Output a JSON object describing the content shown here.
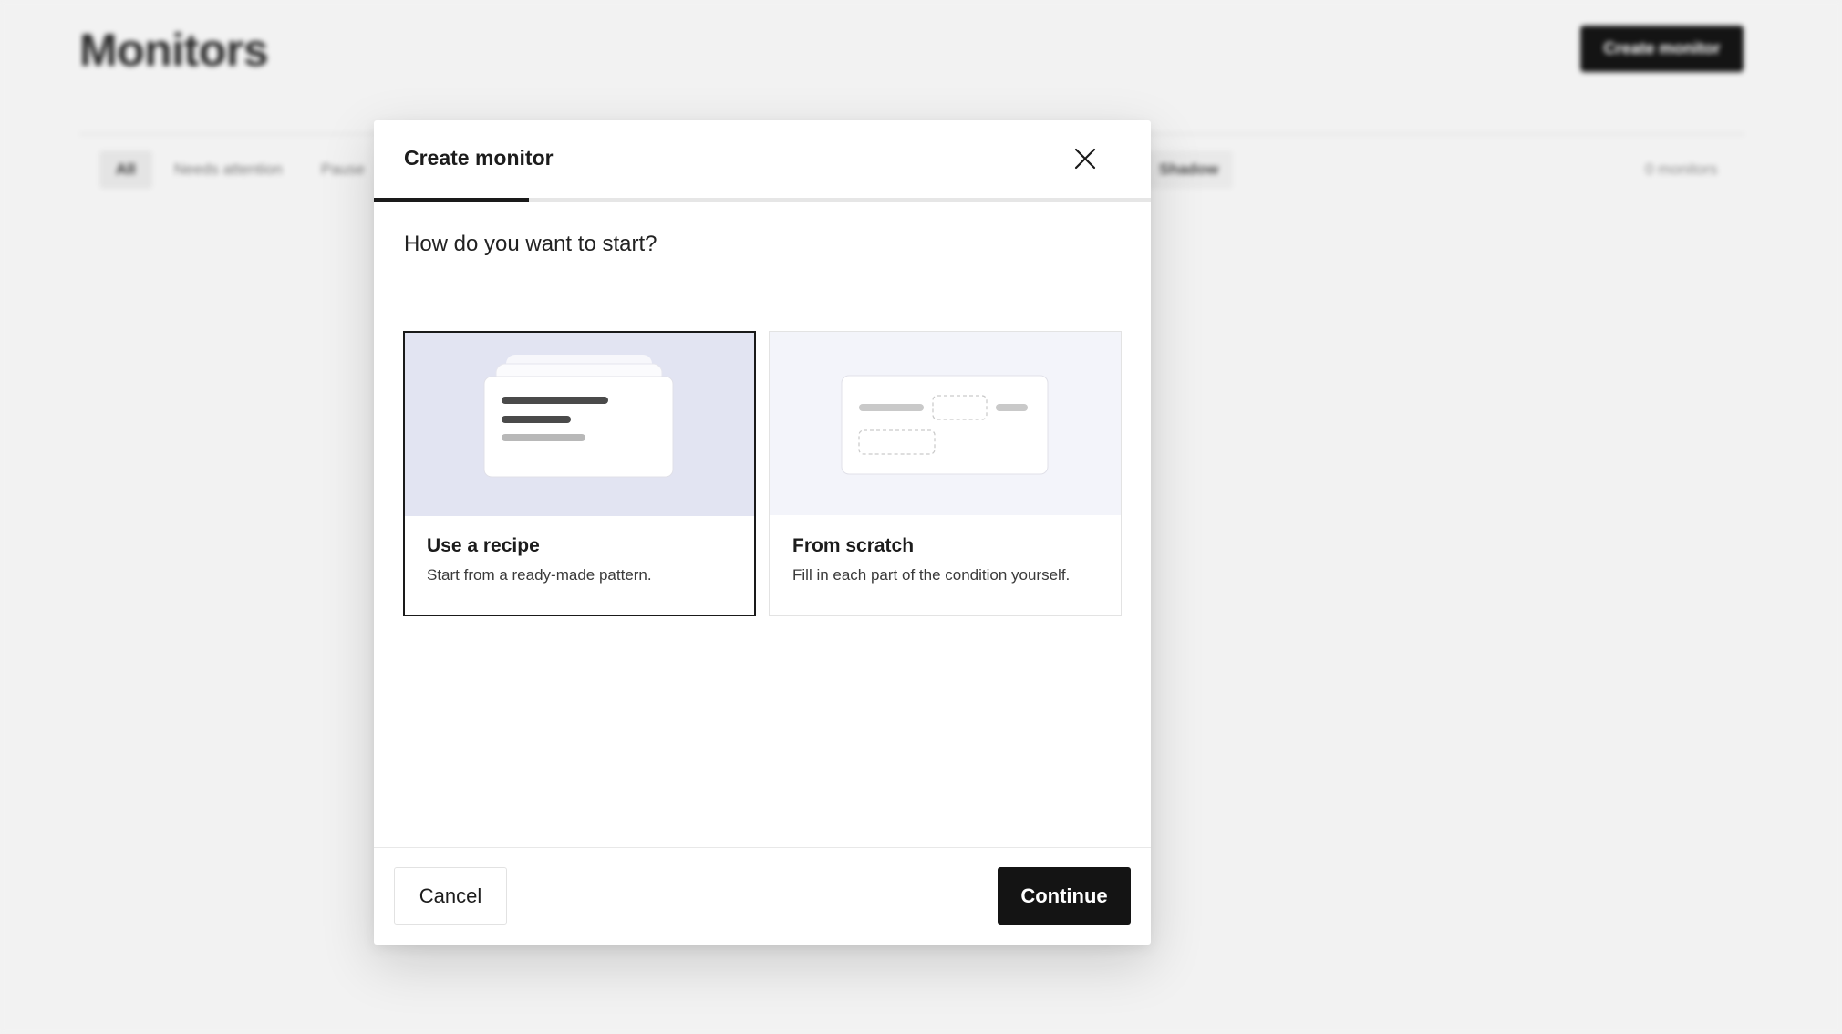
{
  "background": {
    "page_title": "Monitors",
    "create_button_label": "Create monitor",
    "tabs": [
      {
        "label": "All",
        "active": true
      },
      {
        "label": "Needs attention",
        "active": false
      },
      {
        "label": "Pause",
        "active": false
      }
    ],
    "shadow_tab_label": "Shadow",
    "monitor_count": "0 monitors"
  },
  "modal": {
    "title": "Create monitor",
    "close_icon": "close-icon",
    "step_progress": 0.2,
    "question": "How do you want to start?",
    "options": [
      {
        "id": "recipe",
        "title": "Use a recipe",
        "description": "Start from a ready-made pattern.",
        "selected": true,
        "illustration": "stacked-cards-illustration"
      },
      {
        "id": "scratch",
        "title": "From scratch",
        "description": "Fill in each part of the condition yourself.",
        "selected": false,
        "illustration": "blank-condition-illustration"
      }
    ],
    "cancel_label": "Cancel",
    "continue_label": "Continue"
  },
  "colors": {
    "primary_button": "#141414",
    "recipe_illus_bg": "#e2e4f2",
    "scratch_illus_bg": "#f3f4fa",
    "page_bg": "#f2f2f2"
  }
}
